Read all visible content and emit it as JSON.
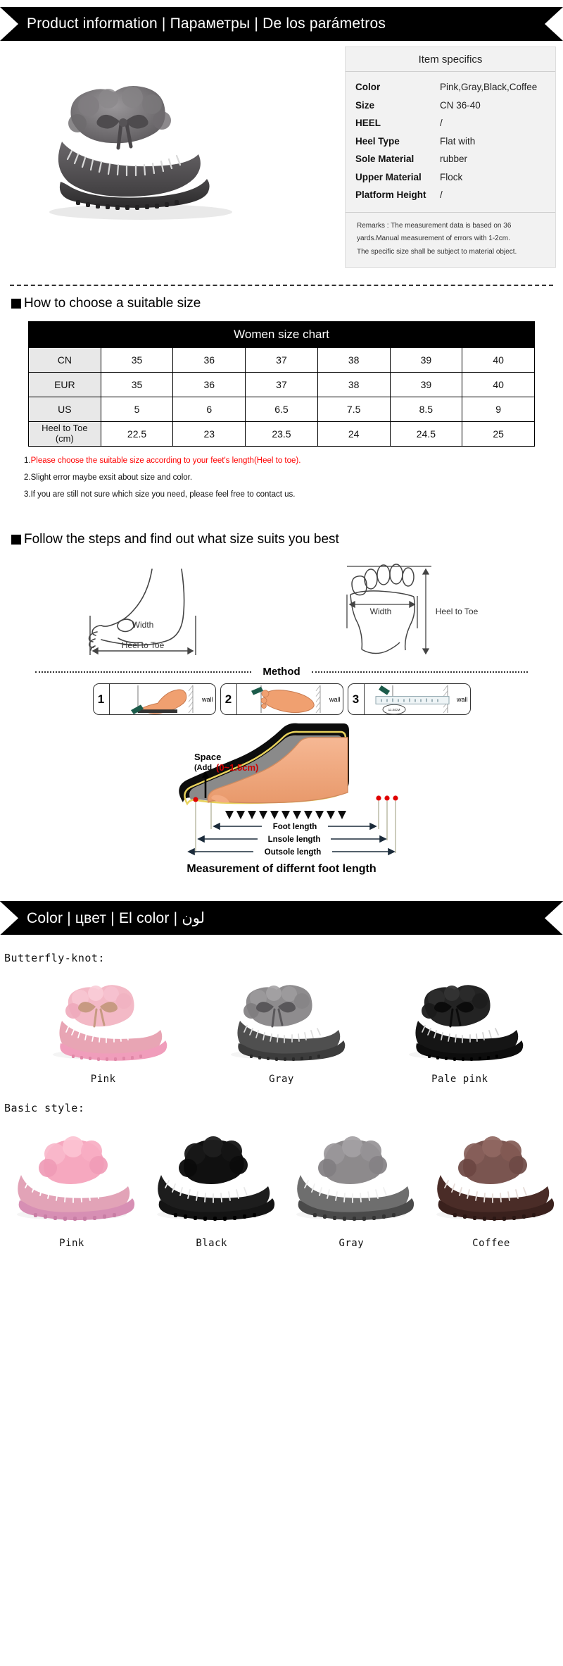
{
  "banners": {
    "product_info": {
      "parts": [
        "Product information",
        "Параметры",
        "De los parámetros"
      ],
      "full": "Product information | Параметры | De los parámetros"
    },
    "color": {
      "parts": [
        "Color",
        "цвет",
        "El color",
        "لون"
      ],
      "full": "Color | цвет | El color | لون"
    }
  },
  "specs": {
    "title": "Item specifics",
    "rows": [
      {
        "key": "Color",
        "value": "Pink,Gray,Black,Coffee"
      },
      {
        "key": "Size",
        "value": "CN 36-40"
      },
      {
        "key": "HEEL",
        "value": "/"
      },
      {
        "key": "Heel Type",
        "value": "Flat with"
      },
      {
        "key": "Sole Material",
        "value": "rubber"
      },
      {
        "key": "Upper Material",
        "value": "Flock"
      },
      {
        "key": "Platform Height",
        "value": "/"
      }
    ],
    "remark_lines": [
      "Remarks : The measurement data is based on 36",
      "yards.Manual measurement of errors with 1-2cm.",
      "The specific size shall be subject to material object."
    ]
  },
  "size_section": {
    "heading": "How to choose a suitable size",
    "chart_title": "Women size chart",
    "rows": [
      {
        "label": "CN",
        "values": [
          "35",
          "36",
          "37",
          "38",
          "39",
          "40"
        ]
      },
      {
        "label": "EUR",
        "values": [
          "35",
          "36",
          "37",
          "38",
          "39",
          "40"
        ]
      },
      {
        "label": "US",
        "values": [
          "5",
          "6",
          "6.5",
          "7.5",
          "8.5",
          "9"
        ]
      },
      {
        "label": "Heel to Toe (cm)",
        "label_line1": "Heel to Toe",
        "label_line2": "(cm)",
        "values": [
          "22.5",
          "23",
          "23.5",
          "24",
          "24.5",
          "25"
        ]
      }
    ],
    "notes": [
      {
        "num": "1.",
        "text": "Please choose the suitable size according to your feet's length(Heel to toe).",
        "color": "#ff0000"
      },
      {
        "num": "2.",
        "text": "Slight error maybe exsit about size and color.",
        "color": "#111111"
      },
      {
        "num": "3.",
        "text": "If you are still not sure which size you need, please feel free to contact us.",
        "color": "#111111"
      }
    ]
  },
  "steps_section": {
    "heading": "Follow the steps and find out what size suits you best",
    "diagram_labels": {
      "side_width": "Width",
      "side_heel_to_toe": "Heel to Toe",
      "top_width": "Width",
      "top_heel_to_toe": "Heel to Toe"
    },
    "method_label": "Method",
    "steps": [
      {
        "num": "1",
        "wall": "wall"
      },
      {
        "num": "2",
        "wall": "wall"
      },
      {
        "num": "3",
        "wall": "wall",
        "ruler_mark": "11.5CM"
      }
    ],
    "big_diagram": {
      "space_label": "Space",
      "space_add": "(Add",
      "space_range": "(0~1.5cm)",
      "measures": [
        "Foot length",
        "Lnsole length",
        "Outsole length"
      ],
      "caption": "Measurement of differnt foot length"
    }
  },
  "colors_section": {
    "butterfly_label": "Butterfly-knot:",
    "butterfly_items": [
      {
        "name": "Pink",
        "upper": "#e8a5b4",
        "fur": "#f3b9c6",
        "sole": "#f09dbb",
        "stitch": "#ffffff"
      },
      {
        "name": "Gray",
        "upper": "#4f4f4f",
        "fur": "#8e8c8e",
        "sole": "#3c3c3c",
        "stitch": "#dcdcdc"
      },
      {
        "name": "Pale pink",
        "upper": "#151515",
        "fur": "#232323",
        "sole": "#0d0d0d",
        "stitch": "#cfcfcf"
      }
    ],
    "basic_label": "Basic style:",
    "basic_items": [
      {
        "name": "Pink",
        "upper": "#e2a3b7",
        "fur": "#f6a8bf",
        "sole": "#d78fb4",
        "stitch": "#ffffff"
      },
      {
        "name": "Black",
        "upper": "#1d1d1d",
        "fur": "#101010",
        "sole": "#141414",
        "stitch": "#e8e8e8"
      },
      {
        "name": "Gray",
        "upper": "#6e6e6e",
        "fur": "#8d8a8c",
        "sole": "#4a4a4a",
        "stitch": "#f0f0f0"
      },
      {
        "name": "Coffee",
        "upper": "#4a2c27",
        "fur": "#7a5550",
        "sole": "#3a211d",
        "stitch": "#e6dcd8"
      }
    ]
  },
  "theme": {
    "banner_bg": "#000000",
    "banner_text": "#ffffff",
    "specs_bg": "#f2f2f2",
    "table_head_bg": "#000000",
    "table_rowhead_bg": "#e8e8e8",
    "note_red": "#ff0000",
    "skin": "#f0a070"
  }
}
